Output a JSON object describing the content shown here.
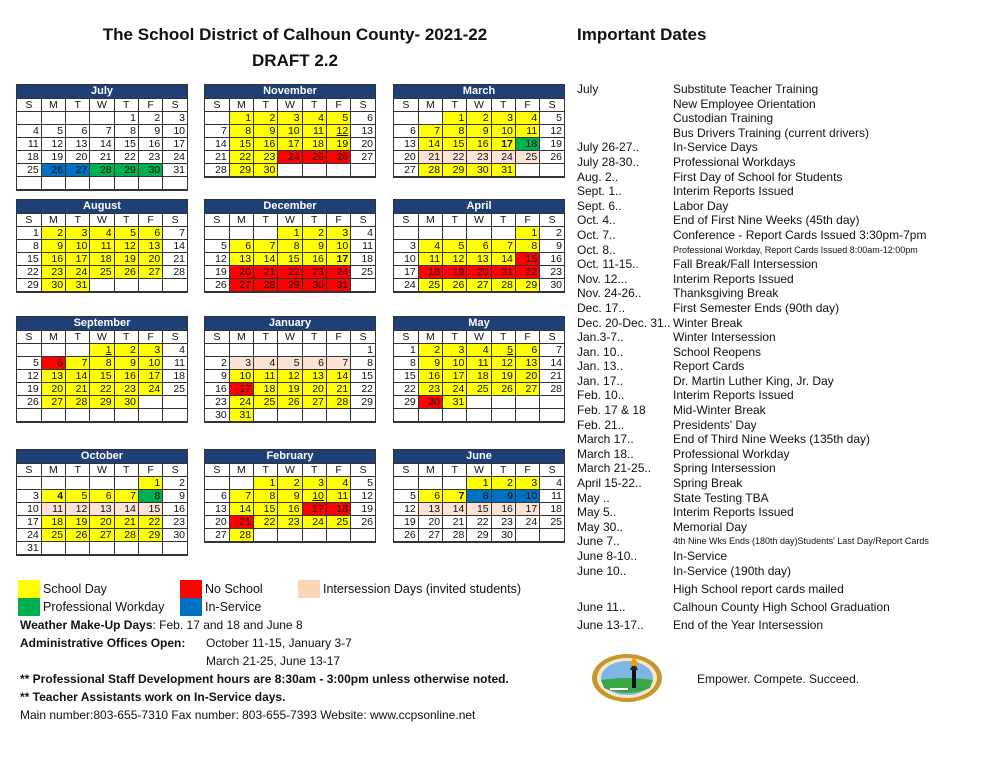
{
  "header": {
    "title": "The School District of Calhoun County- 2021-22",
    "subtitle": "DRAFT 2.2",
    "important_dates_title": "Important Dates"
  },
  "weekday_labels": [
    "S",
    "M",
    "T",
    "W",
    "T",
    "F",
    "S"
  ],
  "colors": {
    "school": "#ffff00",
    "noschool": "#ff0000",
    "inter": "#fbe4d5",
    "prof": "#00b050",
    "inserv": "#0070c0",
    "header": "#1f3f77"
  },
  "months": [
    {
      "name": "July",
      "start": 4,
      "days": 31,
      "rows": 6,
      "school": [],
      "noschool": [],
      "inter": [],
      "prof": [
        28,
        29,
        30
      ],
      "inserv": [
        26,
        27
      ],
      "bold": [],
      "underline": []
    },
    {
      "name": "November",
      "start": 1,
      "days": 30,
      "rows": 5,
      "school": [
        1,
        2,
        3,
        4,
        5,
        8,
        9,
        10,
        11,
        12,
        15,
        16,
        17,
        18,
        19,
        22,
        23,
        29,
        30
      ],
      "noschool": [
        24,
        25,
        26
      ],
      "inter": [],
      "prof": [],
      "inserv": [],
      "bold": [],
      "underline": [
        12
      ]
    },
    {
      "name": "March",
      "start": 2,
      "days": 31,
      "rows": 5,
      "school": [
        1,
        2,
        3,
        4,
        7,
        8,
        9,
        10,
        11,
        14,
        15,
        16,
        17,
        28,
        29,
        30,
        31
      ],
      "noschool": [],
      "inter": [
        21,
        22,
        23,
        24,
        25
      ],
      "prof": [
        18
      ],
      "inserv": [],
      "bold": [
        17
      ],
      "underline": []
    },
    {
      "name": "August",
      "start": 0,
      "days": 31,
      "rows": 5,
      "school": [
        2,
        3,
        4,
        5,
        6,
        9,
        10,
        11,
        12,
        13,
        16,
        17,
        18,
        19,
        20,
        23,
        24,
        25,
        26,
        27,
        30,
        31
      ],
      "noschool": [],
      "inter": [],
      "prof": [],
      "inserv": [],
      "bold": [],
      "underline": []
    },
    {
      "name": "December",
      "start": 3,
      "days": 31,
      "rows": 5,
      "school": [
        1,
        2,
        3,
        6,
        7,
        8,
        9,
        10,
        13,
        14,
        15,
        16,
        17
      ],
      "noschool": [
        20,
        21,
        22,
        23,
        24,
        27,
        28,
        29,
        30,
        31
      ],
      "inter": [],
      "prof": [],
      "inserv": [],
      "bold": [
        17
      ],
      "underline": []
    },
    {
      "name": "April",
      "start": 5,
      "days": 30,
      "rows": 5,
      "school": [
        1,
        4,
        5,
        6,
        7,
        8,
        11,
        12,
        13,
        14,
        25,
        26,
        27,
        28,
        29
      ],
      "noschool": [
        15,
        18,
        19,
        20,
        21,
        22
      ],
      "inter": [],
      "prof": [],
      "inserv": [],
      "bold": [],
      "underline": []
    },
    {
      "name": "September",
      "start": 3,
      "days": 30,
      "rows": 6,
      "school": [
        1,
        2,
        3,
        7,
        8,
        9,
        10,
        13,
        14,
        15,
        16,
        17,
        20,
        21,
        22,
        23,
        24,
        27,
        28,
        29,
        30
      ],
      "noschool": [
        6
      ],
      "inter": [],
      "prof": [],
      "inserv": [],
      "bold": [],
      "underline": [
        1
      ]
    },
    {
      "name": "January",
      "start": 6,
      "days": 31,
      "rows": 6,
      "school": [
        10,
        11,
        12,
        13,
        14,
        18,
        19,
        20,
        21,
        24,
        25,
        26,
        27,
        28,
        31
      ],
      "noschool": [
        17
      ],
      "inter": [
        3,
        4,
        5,
        6,
        7
      ],
      "prof": [],
      "inserv": [],
      "bold": [],
      "underline": []
    },
    {
      "name": "May",
      "start": 0,
      "days": 31,
      "rows": 6,
      "school": [
        2,
        3,
        4,
        5,
        6,
        9,
        10,
        11,
        12,
        13,
        16,
        17,
        18,
        19,
        20,
        23,
        24,
        25,
        26,
        27,
        31
      ],
      "noschool": [
        30
      ],
      "inter": [],
      "prof": [],
      "inserv": [],
      "bold": [],
      "underline": [
        5
      ]
    },
    {
      "name": "October",
      "start": 5,
      "days": 31,
      "rows": 6,
      "school": [
        1,
        4,
        5,
        6,
        7,
        18,
        19,
        20,
        21,
        22,
        25,
        26,
        27,
        28,
        29
      ],
      "noschool": [],
      "inter": [
        11,
        12,
        13,
        14,
        15
      ],
      "prof": [
        8
      ],
      "inserv": [],
      "bold": [
        4
      ],
      "underline": []
    },
    {
      "name": "February",
      "start": 2,
      "days": 28,
      "rows": 5,
      "school": [
        1,
        2,
        3,
        4,
        7,
        8,
        9,
        10,
        11,
        14,
        15,
        16,
        22,
        23,
        24,
        25,
        28
      ],
      "noschool": [
        17,
        18,
        21
      ],
      "inter": [],
      "prof": [],
      "inserv": [],
      "bold": [],
      "underline": [
        10
      ]
    },
    {
      "name": "June",
      "start": 3,
      "days": 30,
      "rows": 5,
      "school": [
        1,
        2,
        3,
        6,
        7
      ],
      "noschool": [],
      "inter": [
        13,
        14,
        15,
        16,
        17
      ],
      "prof": [],
      "inserv": [
        8,
        9,
        10
      ],
      "bold": [
        7
      ],
      "underline": []
    }
  ],
  "legend": {
    "school_day": "School Day",
    "no_school": "No School",
    "intersession": "Intersession Days (invited students)",
    "professional_workday": "Professional Workday",
    "in_service": "In-Service"
  },
  "notes": {
    "weather_label": "Weather Make-Up Days",
    "weather_value": ": Feb. 17 and 18 and June 8",
    "admin_label": "Administrative Offices Open:",
    "admin_line1": "October 11-15, January 3-7",
    "admin_line2": "March 21-25, June 13-17",
    "staff_dev": "** Professional Staff Development hours are 8:30am - 3:00pm unless otherwise noted.",
    "assistants": "** Teacher Assistants work on In-Service days.",
    "contact": "Main number:803-655-7310  Fax number: 803-655-7393  Website: www.ccpsonline.net"
  },
  "important_dates": [
    {
      "date": "July",
      "event": "Substitute Teacher Training"
    },
    {
      "date": "",
      "event": "New Employee Orientation"
    },
    {
      "date": "",
      "event": "Custodian Training"
    },
    {
      "date": "",
      "event": "Bus Drivers Training (current drivers)"
    },
    {
      "date": "July 26-27..",
      "event": "In-Service Days"
    },
    {
      "date": "July 28-30..",
      "event": "Professional Workdays"
    },
    {
      "date": "Aug. 2..",
      "event": "First Day of School for Students"
    },
    {
      "date": "Sept. 1..",
      "event": "Interim Reports Issued"
    },
    {
      "date": "Sept. 6..",
      "event": "Labor Day"
    },
    {
      "date": "Oct. 4..",
      "event": "End of First Nine Weeks (45th day)"
    },
    {
      "date": "Oct. 7..",
      "event": "Conference - Report Cards Issued 3:30pm-7pm"
    },
    {
      "date": "Oct. 8..",
      "event": "Professional Workday, Report Cards Issued 8:00am-12:00pm",
      "small": true
    },
    {
      "date": "Oct. 11-15..",
      "event": "Fall Break/Fall Intersession"
    },
    {
      "date": "Nov. 12...",
      "event": "Interim Reports Issued"
    },
    {
      "date": "Nov. 24-26..",
      "event": "Thanksgiving Break"
    },
    {
      "date": "Dec. 17..",
      "event": "First Semester Ends (90th day)"
    },
    {
      "date": "Dec. 20-Dec. 31..",
      "event": "Winter Break"
    },
    {
      "date": "Jan.3-7..",
      "event": "Winter Intersession"
    },
    {
      "date": "Jan. 10..",
      "event": "School Reopens"
    },
    {
      "date": "Jan. 13..",
      "event": "Report Cards"
    },
    {
      "date": "Jan. 17..",
      "event": "Dr. Martin Luther King, Jr. Day"
    },
    {
      "date": "Feb. 10..",
      "event": "Interim Reports Issued"
    },
    {
      "date": "Feb. 17 & 18",
      "event": "Mid-Winter Break"
    },
    {
      "date": "Feb. 21..",
      "event": "Presidents' Day"
    },
    {
      "date": "March 17..",
      "event": "End of Third Nine Weeks (135th day)"
    },
    {
      "date": "March 18..",
      "event": "Professional Workday"
    },
    {
      "date": "March 21-25..",
      "event": "Spring Intersession"
    },
    {
      "date": "April 15-22..",
      "event": "Spring Break"
    },
    {
      "date": "May ..",
      "event": "State Testing TBA"
    },
    {
      "date": "May 5..",
      "event": "Interim Reports Issued"
    },
    {
      "date": "May 30..",
      "event": "Memorial Day"
    },
    {
      "date": "June 7..",
      "event": "4th Nine Wks Ends (180th day)Students' Last Day/Report Cards",
      "small": true
    },
    {
      "date": "June 8-10..",
      "event": "In-Service"
    },
    {
      "date": "June 10..",
      "event": "In-Service (190th day)"
    },
    {
      "date": "",
      "event": "High School report cards mailed",
      "gap": true
    },
    {
      "date": "June 11..",
      "event": "Calhoun County High School Graduation",
      "gap": true
    },
    {
      "date": "June 13-17..",
      "event": "End of the Year Intersession",
      "gap": true
    }
  ],
  "footer": {
    "logo": "district-seal-logo",
    "motto": "Empower. Compete. Succeed."
  }
}
